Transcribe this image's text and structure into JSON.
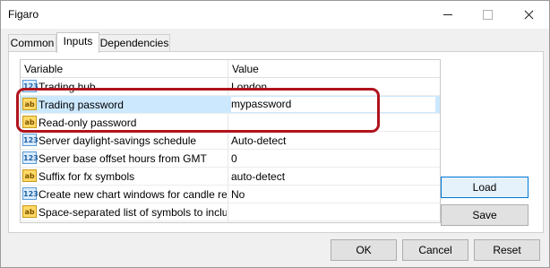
{
  "window": {
    "title": "Figaro"
  },
  "tabs": [
    {
      "label": "Common"
    },
    {
      "label": "Inputs"
    },
    {
      "label": "Dependencies"
    }
  ],
  "grid": {
    "headers": {
      "variable": "Variable",
      "value": "Value"
    },
    "rows": [
      {
        "name": "Trading hub",
        "value": "London",
        "type": "number-icon"
      },
      {
        "name": "Trading password",
        "value": "mypassword",
        "type": "text-icon"
      },
      {
        "name": "Read-only password",
        "value": "",
        "type": "text-icon"
      },
      {
        "name": "Server daylight-savings schedule",
        "value": "Auto-detect",
        "type": "number-icon"
      },
      {
        "name": "Server base offset hours from GMT",
        "value": "0",
        "type": "number-icon"
      },
      {
        "name": "Suffix for fx symbols",
        "value": "auto-detect",
        "type": "text-icon"
      },
      {
        "name": "Create new chart windows for candle req...",
        "value": "No",
        "type": "number-icon"
      },
      {
        "name": "Space-separated list of symbols to include...",
        "value": "",
        "type": "text-icon"
      }
    ]
  },
  "icons": {
    "number_glyph": "123",
    "text_glyph": "ab"
  },
  "buttons": {
    "load": "Load",
    "save": "Save",
    "ok": "OK",
    "cancel": "Cancel",
    "reset": "Reset"
  },
  "colors": {
    "highlight": "#b0131d",
    "selection": "#cce8ff"
  }
}
